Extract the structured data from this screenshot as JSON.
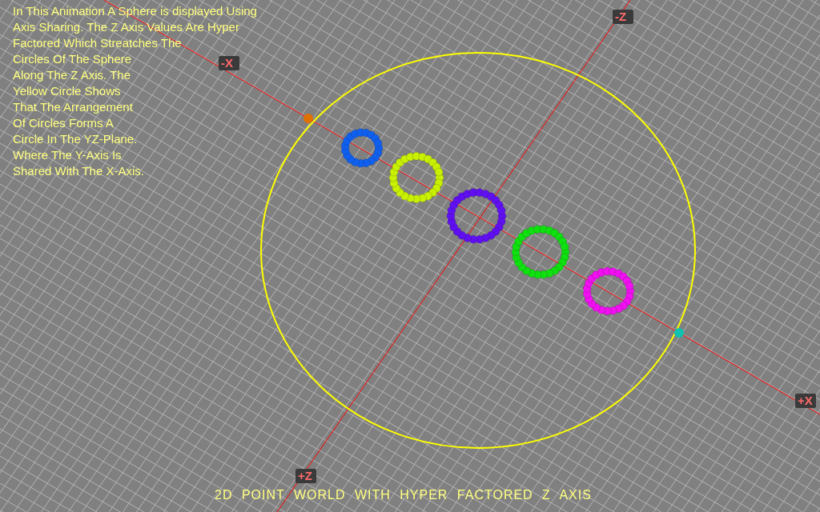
{
  "description": {
    "lines": [
      "In This Animation A Sphere is displayed Using",
      "Axis Sharing. The Z Axis Values Are Hyper",
      "Factored Which Streatches The",
      "Circles Of The Sphere",
      "Along The Z Axis. The",
      "Yellow Circle Shows",
      "That The Arrangement",
      "Of Circles Forms A",
      "Circle In The YZ-Plane.",
      "Where The Y-Axis Is",
      "Shared With The X-Axis."
    ]
  },
  "axis_labels": [
    {
      "text": "-Z"
    },
    {
      "text": "-X"
    },
    {
      "text": "+X"
    },
    {
      "text": "+Z"
    }
  ],
  "rings": [
    {
      "color": "#1060f0"
    },
    {
      "color": "#c8f000"
    },
    {
      "color": "#6010f0"
    },
    {
      "color": "#10e010"
    },
    {
      "color": "#f010f0"
    }
  ],
  "markers": [
    {
      "color": "#e07000"
    },
    {
      "color": "#10c0b0"
    }
  ],
  "caption": "2D POINT WORLD WITH HYPER FACTORED Z AXIS"
}
